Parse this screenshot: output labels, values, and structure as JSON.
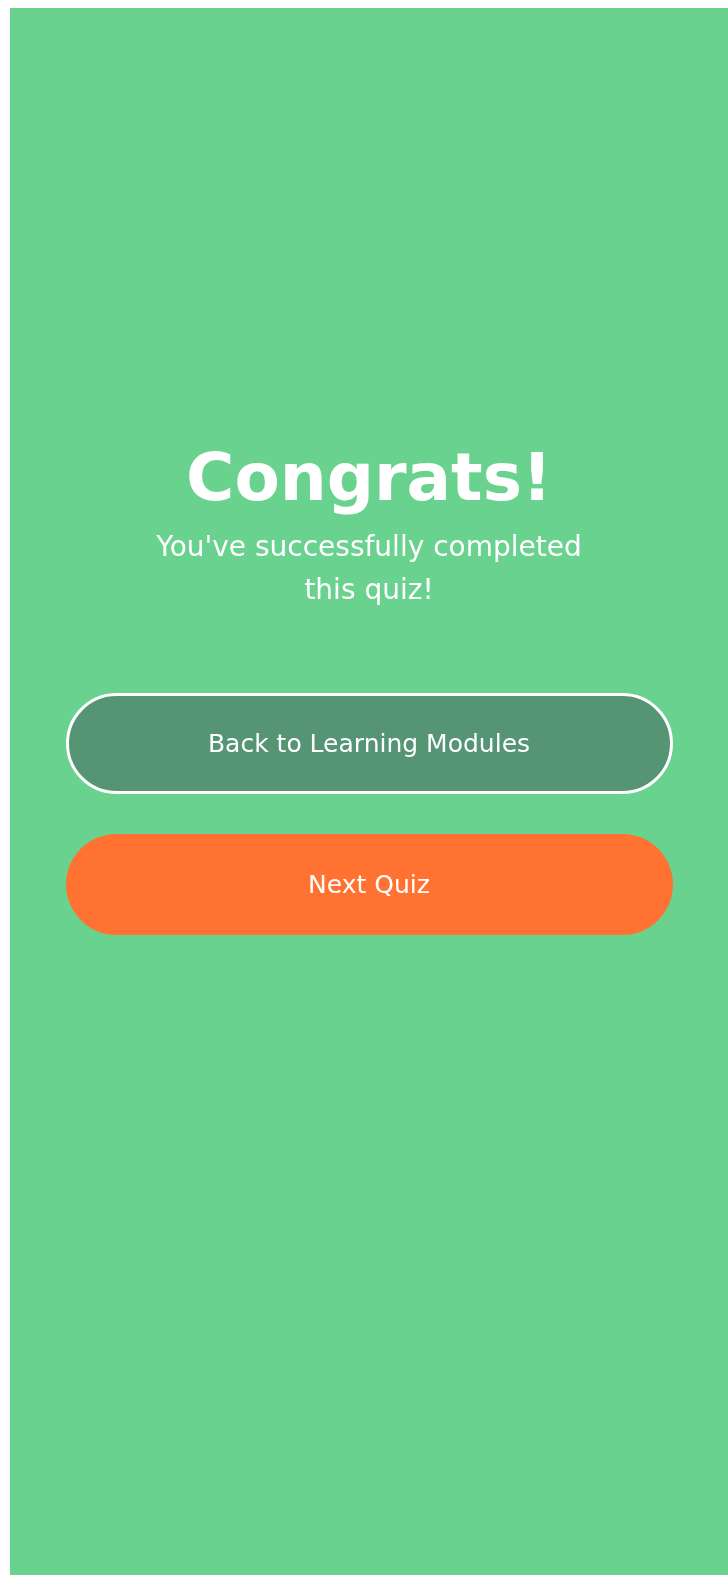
{
  "title": "Congrats!",
  "message": "You've successfully completed this quiz!",
  "buttons": [
    {
      "label": "Back to Learning Modules",
      "kind": "secondary"
    },
    {
      "label": "Next Quiz",
      "kind": "primary"
    }
  ]
}
